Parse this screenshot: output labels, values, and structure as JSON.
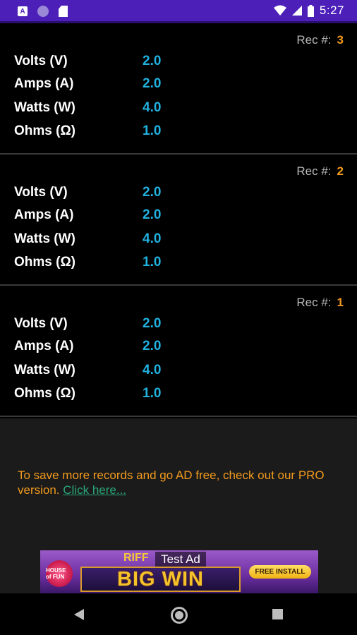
{
  "status_bar": {
    "time": "5:27",
    "left_icons": [
      "a-notification-icon",
      "circle-notification-icon",
      "sd-card-icon"
    ],
    "right_icons": [
      "wifi-icon",
      "signal-icon",
      "battery-icon"
    ]
  },
  "records": [
    {
      "rec_label": "Rec #:",
      "rec_number": "3",
      "rows": [
        {
          "label": "Volts (V)",
          "value": "2.0"
        },
        {
          "label": "Amps (A)",
          "value": "2.0"
        },
        {
          "label": "Watts (W)",
          "value": "4.0"
        },
        {
          "label": "Ohms (Ω)",
          "value": "1.0"
        }
      ]
    },
    {
      "rec_label": "Rec #:",
      "rec_number": "2",
      "rows": [
        {
          "label": "Volts (V)",
          "value": "2.0"
        },
        {
          "label": "Amps (A)",
          "value": "2.0"
        },
        {
          "label": "Watts (W)",
          "value": "4.0"
        },
        {
          "label": "Ohms (Ω)",
          "value": "1.0"
        }
      ]
    },
    {
      "rec_label": "Rec #:",
      "rec_number": "1",
      "rows": [
        {
          "label": "Volts (V)",
          "value": "2.0"
        },
        {
          "label": "Amps (A)",
          "value": "2.0"
        },
        {
          "label": "Watts (W)",
          "value": "4.0"
        },
        {
          "label": "Ohms (Ω)",
          "value": "1.0"
        }
      ]
    }
  ],
  "promo": {
    "text": "To save more records and go AD free, check out our PRO version.",
    "link": "Click here..."
  },
  "ad": {
    "test_label": "Test Ad",
    "brand": "RIFF",
    "title": "BIG WIN",
    "install": "FREE INSTALL",
    "logo_text": "HOUSE of FUN"
  },
  "colors": {
    "status_bar": "#4b1fb8",
    "accent_orange": "#f29a1d",
    "value_blue": "#21b2e0",
    "link_green": "#2aa77a"
  }
}
